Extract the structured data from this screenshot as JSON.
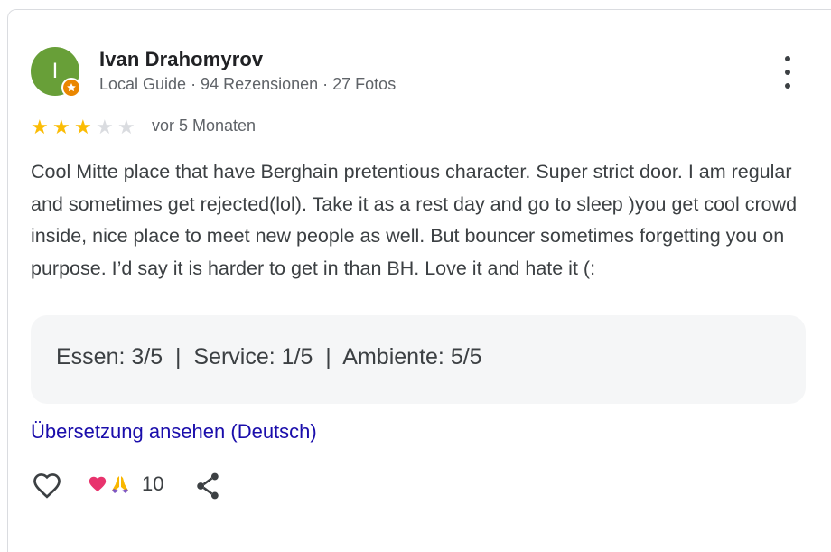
{
  "reviewer": {
    "initial": "I",
    "name": "Ivan Drahomyrov",
    "meta": "Local Guide · 94 Rezensionen · 27 Fotos"
  },
  "rating": {
    "stars": 3,
    "max": 5,
    "time": "vor 5 Monaten"
  },
  "review_text": "Cool Mitte place that have Berghain pretentious character. Super strict door. I am regular and sometimes get rejected(lol). Take it as a rest day and go to sleep )you get cool crowd inside, nice place to meet new people as well. But bouncer sometimes forgetting you on purpose. I’d say it is harder to get in than BH. Love it and hate it (:",
  "sub_ratings": "Essen: 3/5  |  Service: 1/5  |  Ambiente: 5/5",
  "translate_link": "Übersetzung ansehen (Deutsch)",
  "reactions": {
    "count": "10"
  },
  "icons": {
    "like": "heart-outline-icon",
    "reaction_1": "red-heart-icon",
    "reaction_2": "folded-hands-icon",
    "share": "share-icon",
    "more": "more-vert-icon"
  },
  "colors": {
    "avatar": "#689f38",
    "star": "#fbbc04",
    "link": "#1a0dab"
  }
}
